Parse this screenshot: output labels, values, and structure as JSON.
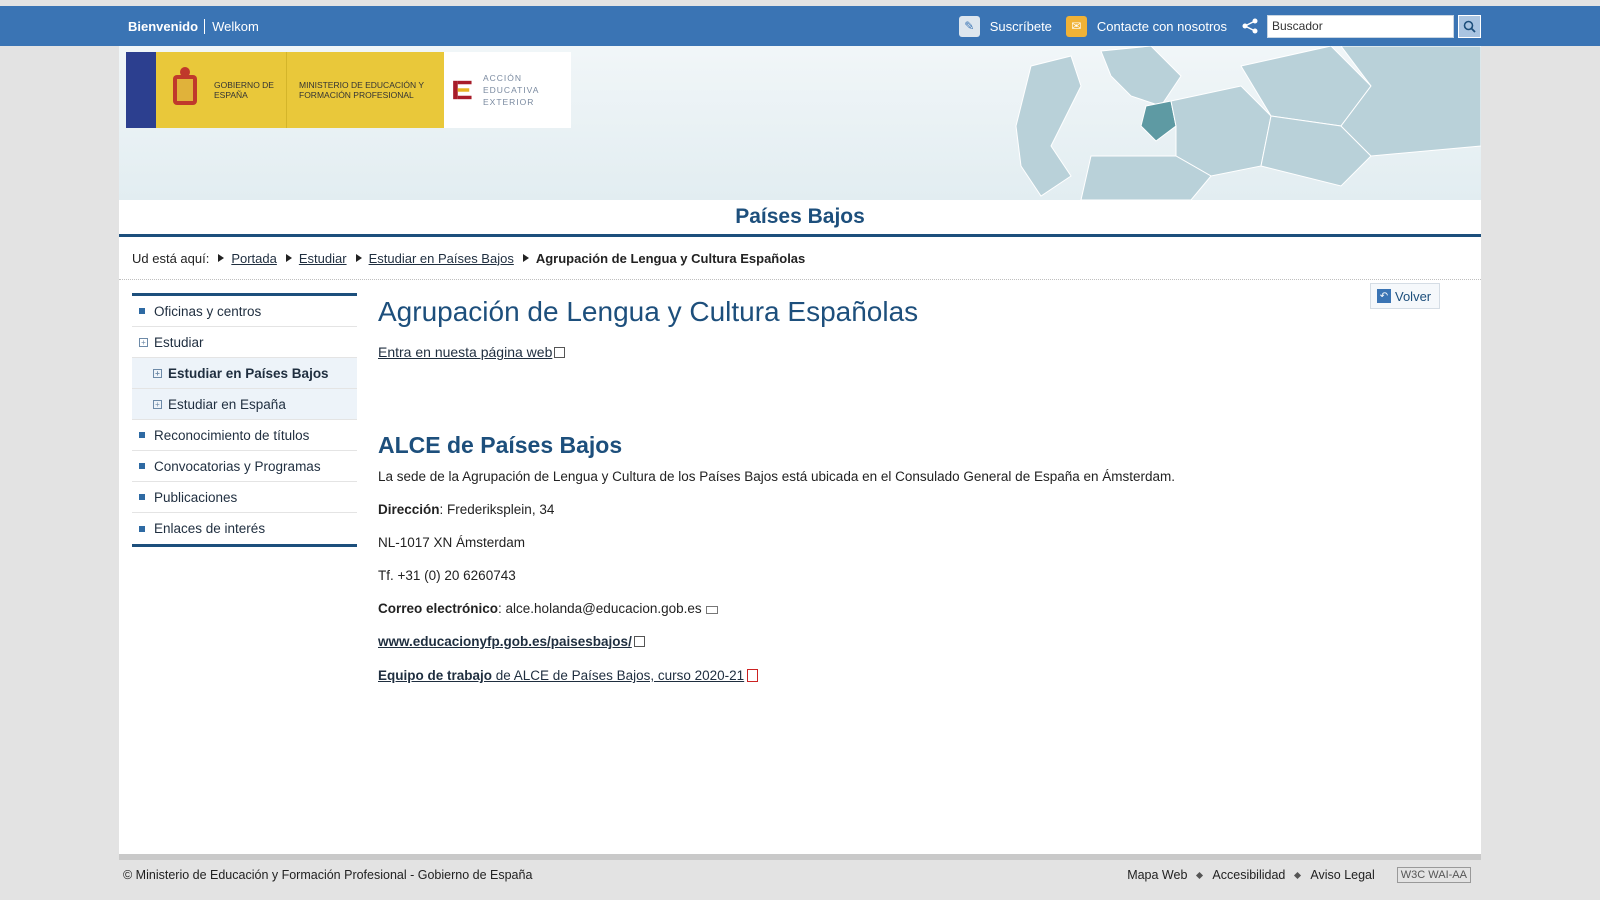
{
  "topbar": {
    "lang_active": "Bienvenido",
    "lang_other": "Welkom",
    "subscribe": "Suscríbete",
    "contact": "Contacte con nosotros",
    "search_placeholder": "Buscador"
  },
  "banner": {
    "gov_text": "Gobierno de España",
    "ministry_text": "Ministerio de Educación y Formación Profesional",
    "aee_text": "Acción Educativa Exterior"
  },
  "country_title": "Países Bajos",
  "breadcrumb": {
    "label": "Ud está aquí:",
    "items": [
      "Portada",
      "Estudiar",
      "Estudiar en Países Bajos"
    ],
    "current": "Agrupación de Lengua y Cultura Españolas"
  },
  "sidebar": {
    "items": [
      "Oficinas y centros",
      "Estudiar",
      "Estudiar en Países Bajos",
      "Estudiar en España",
      "Reconocimiento de títulos",
      "Convocatorias y Programas",
      "Publicaciones",
      "Enlaces de interés"
    ]
  },
  "main": {
    "back_label": "Volver",
    "title": "Agrupación de Lengua y Cultura Españolas",
    "web_link": "Entra en nuesta página web",
    "section_title": "ALCE de Países Bajos",
    "intro": "La sede de la Agrupación de Lengua y Cultura de los Países Bajos está ubicada en el Consulado General de España en Ámsterdam.",
    "address_label": "Dirección",
    "address_value": ": Frederiksplein, 34",
    "city": "NL-1017 XN Ámsterdam",
    "phone": "Tf. +31 (0) 20 6260743",
    "email_label": "Correo electrónico",
    "email_value": ": alce.holanda@educacion.gob.es",
    "site_link": "www.educacionyfp.gob.es/paisesbajos/",
    "team_bold": "Equipo de trabajo",
    "team_rest": " de ALCE de Países Bajos, curso 2020-21"
  },
  "footer": {
    "copyright": "© Ministerio de Educación y Formación Profesional - Gobierno de España",
    "links": [
      "Mapa Web",
      "Accesibilidad",
      "Aviso Legal"
    ],
    "badge": "W3C WAI-AA"
  },
  "colors": {
    "topbar": "#3a74b4",
    "title_blue": "#1d4f7c",
    "background": "#e3e3e3"
  }
}
